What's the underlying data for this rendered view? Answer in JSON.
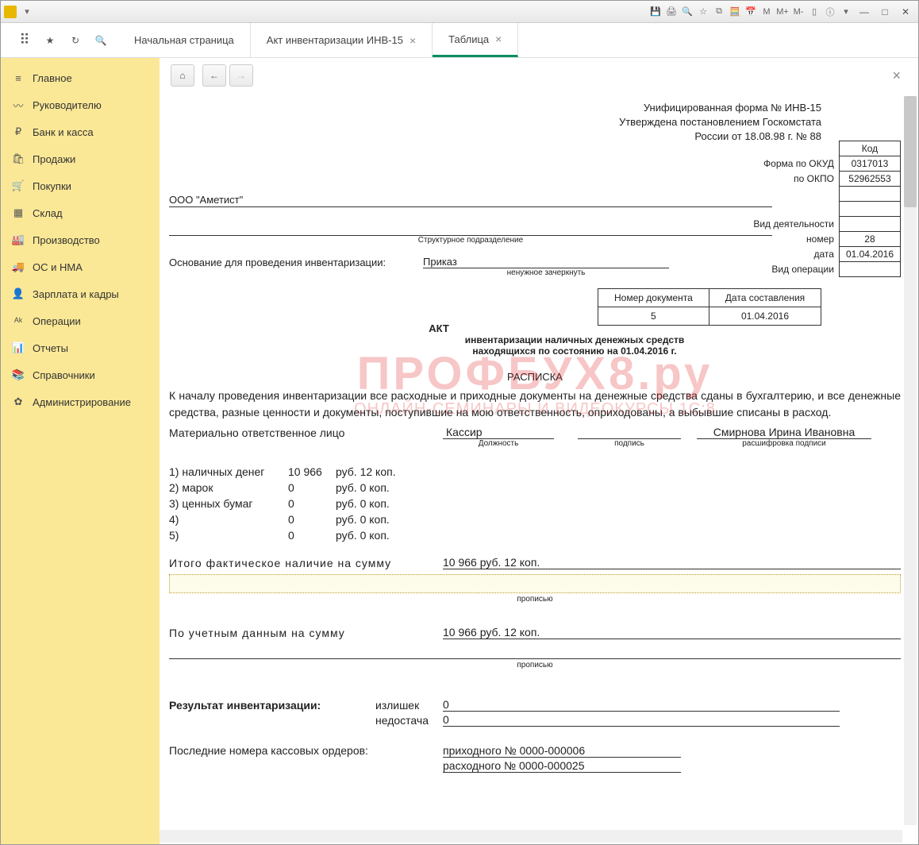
{
  "tabs": [
    {
      "label": "Начальная страница",
      "closable": false,
      "active": false
    },
    {
      "label": "Акт инвентаризации ИНВ-15",
      "closable": true,
      "active": false
    },
    {
      "label": "Таблица",
      "closable": true,
      "active": true
    }
  ],
  "sidebar": {
    "items": [
      {
        "icon": "≡",
        "label": "Главное"
      },
      {
        "icon": "〰",
        "label": "Руководителю"
      },
      {
        "icon": "₽",
        "label": "Банк и касса"
      },
      {
        "icon": "🛍",
        "label": "Продажи"
      },
      {
        "icon": "🛒",
        "label": "Покупки"
      },
      {
        "icon": "▦",
        "label": "Склад"
      },
      {
        "icon": "🏭",
        "label": "Производство"
      },
      {
        "icon": "🚚",
        "label": "ОС и НМА"
      },
      {
        "icon": "👤",
        "label": "Зарплата и кадры"
      },
      {
        "icon": "ᴬᵏ",
        "label": "Операции"
      },
      {
        "icon": "📊",
        "label": "Отчеты"
      },
      {
        "icon": "📚",
        "label": "Справочники"
      },
      {
        "icon": "✿",
        "label": "Администрирование"
      }
    ]
  },
  "document": {
    "form_header1": "Унифицированная форма № ИНВ-15",
    "form_header2": "Утверждена постановлением Госкомстата",
    "form_header3": "России от 18.08.98 г. № 88",
    "code_label": "Код",
    "okud_label": "Форма по ОКУД",
    "okud": "0317013",
    "okpo_label": "по ОКПО",
    "okpo": "52962553",
    "activity_label": "Вид деятельности",
    "number_label": "номер",
    "number": "28",
    "date_label": "дата",
    "date": "01.04.2016",
    "op_type_label": "Вид операции",
    "org_name": "ООО \"Аметист\"",
    "struct_label": "Структурное подразделение",
    "basis_label": "Основание для проведения инвентаризации:",
    "basis_value": "Приказ",
    "basis_note": "ненужное зачеркнуть",
    "doc_num_header": "Номер документа",
    "doc_num": "5",
    "doc_date_header": "Дата составления",
    "doc_date": "01.04.2016",
    "act_title": "АКТ",
    "act_sub1": "инвентаризации наличных денежных средств",
    "act_sub2": "находящихся по состоянию на 01.04.2016 г.",
    "receipt_title": "РАСПИСКА",
    "receipt_text": "К началу проведения инвентаризации все расходные и приходные документы на денежные средства сданы в бухгалтерию, и все денежные средства, разные ценности и документы, поступившие на мою ответственность, оприходованы, а выбывшие списаны в расход.",
    "resp_label": "Материально ответственное лицо",
    "resp_position": "Кассир",
    "resp_position_lbl": "Должность",
    "resp_sign_lbl": "подпись",
    "resp_name": "Смирнова Ирина Ивановна",
    "resp_name_lbl": "расшифровка подписи",
    "items": [
      {
        "n": "1) наличных денег",
        "val": "10 966",
        "curr": "руб. 12 коп."
      },
      {
        "n": "2) марок",
        "val": "0",
        "curr": "руб. 0 коп."
      },
      {
        "n": "3) ценных бумаг",
        "val": "0",
        "curr": "руб. 0 коп."
      },
      {
        "n": "4)",
        "val": "0",
        "curr": "руб. 0 коп."
      },
      {
        "n": "5)",
        "val": "0",
        "curr": "руб. 0 коп."
      }
    ],
    "total_label": "Итого фактическое наличие на сумму",
    "total_value": "10 966 руб. 12 коп.",
    "inwords_label": "прописью",
    "accounting_label": "По учетным данным на сумму",
    "accounting_value": "10 966 руб. 12 коп.",
    "result_label": "Результат инвентаризации:",
    "surplus_label": "излишек",
    "surplus": "0",
    "shortage_label": "недостача",
    "shortage": "0",
    "orders_label": "Последние номера кассовых ордеров:",
    "order_in_label": "приходного № 0000-000006",
    "order_out_label": "расходного № 0000-000025"
  },
  "watermark": {
    "top": "ПРОФБУХ8.ру",
    "bottom": "ОНЛАЙН-СЕМИНАРЫ И ВИДЕОКУРСЫ 1С:8"
  }
}
